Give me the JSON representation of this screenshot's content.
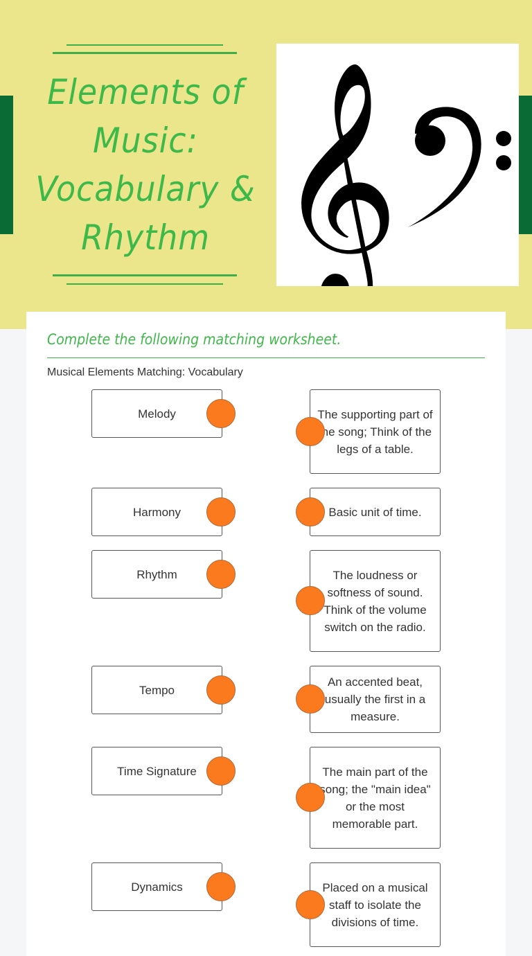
{
  "header": {
    "title": "Elements of Music: Vocabulary & Rhythm",
    "image_label": "treble-and-bass-clefs",
    "colors": {
      "background": "#ebe68c",
      "accent_green": "#3fb84a",
      "side_band": "#0a6b34"
    }
  },
  "worksheet": {
    "instructions": "Complete the following matching worksheet.",
    "section_label": "Musical Elements Matching: Vocabulary",
    "terms": [
      {
        "label": "Melody"
      },
      {
        "label": "Harmony"
      },
      {
        "label": "Rhythm"
      },
      {
        "label": "Tempo"
      },
      {
        "label": "Time Signature"
      },
      {
        "label": "Dynamics"
      }
    ],
    "definitions": [
      {
        "text": "The supporting part of the song; Think of the legs of a table."
      },
      {
        "text": "Basic unit of time."
      },
      {
        "text": "The loudness or softness of sound. Think of the volume switch on the radio."
      },
      {
        "text": "An accented beat, usually the first in a measure."
      },
      {
        "text": "The main part of the song; the \"main idea\" or the most memorable part."
      },
      {
        "text": "Placed on a musical staff to isolate the divisions of time."
      }
    ],
    "connector_color": "#fc7a1e"
  }
}
